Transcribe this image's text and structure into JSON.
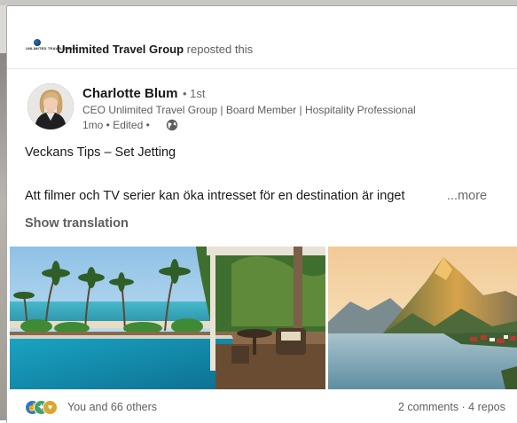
{
  "repost": {
    "org_name": "Unlimited Travel Group",
    "action_text": "reposted this",
    "logo_text": "UNLIMITED TRAVEL GROUP"
  },
  "author": {
    "name": "Charlotte Blum",
    "degree": "• 1st",
    "headline": "CEO Unlimited Travel Group | Board Member | Hospitality Professional",
    "meta": "1mo • Edited •"
  },
  "post": {
    "title": "Veckans Tips – Set Jetting",
    "body": "Att filmer och TV serier kan öka intresset för en destination är inget",
    "more_label": "...more",
    "translate_label": "Show translation"
  },
  "media": {
    "images": [
      "resort-pool-photo",
      "fjord-mountain-photo"
    ]
  },
  "social": {
    "reactions_label": "You and 66 others",
    "engagement_label": "2 comments · 4 repos",
    "reaction_icons": [
      "like-icon",
      "celebrate-icon",
      "support-icon"
    ]
  },
  "colors": {
    "link_gray": "#5e5e5e",
    "like_blue": "#2e78c5",
    "celebrate_green": "#44a06a",
    "support_yellow": "#d9a630"
  }
}
